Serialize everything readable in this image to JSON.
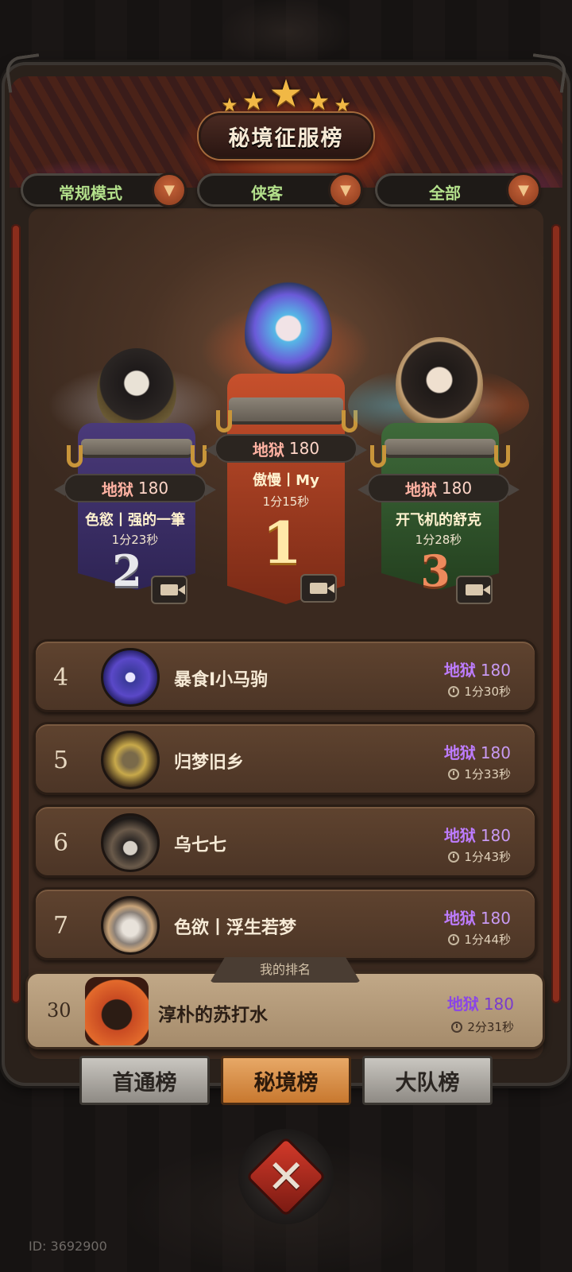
{
  "title": "秘境征服榜",
  "filters": [
    {
      "label": "常规模式"
    },
    {
      "label": "侠客"
    },
    {
      "label": "全部"
    }
  ],
  "podium": {
    "first": {
      "rank": "1",
      "tier": "地狱",
      "level": "180",
      "name": "傲慢丨My",
      "time": "1分15秒"
    },
    "second": {
      "rank": "2",
      "tier": "地狱",
      "level": "180",
      "name": "色慾丨强的一筆",
      "time": "1分23秒"
    },
    "third": {
      "rank": "3",
      "tier": "地狱",
      "level": "180",
      "name": "开飞机的舒克",
      "time": "1分28秒"
    }
  },
  "list": [
    {
      "rank": "4",
      "name": "暴食I小马驹",
      "tier": "地狱",
      "level": "180",
      "time": "1分30秒"
    },
    {
      "rank": "5",
      "name": "归梦旧乡",
      "tier": "地狱",
      "level": "180",
      "time": "1分33秒"
    },
    {
      "rank": "6",
      "name": "乌七七",
      "tier": "地狱",
      "level": "180",
      "time": "1分43秒"
    },
    {
      "rank": "7",
      "name": "色欲丨浮生若梦",
      "tier": "地狱",
      "level": "180",
      "time": "1分44秒"
    }
  ],
  "my_rank": {
    "tag": "我的排名",
    "rank": "30",
    "name": "淳朴的苏打水",
    "tier": "地狱",
    "level": "180",
    "time": "2分31秒"
  },
  "tabs": [
    {
      "label": "首通榜"
    },
    {
      "label": "秘境榜"
    },
    {
      "label": "大队榜"
    }
  ],
  "close_symbol": "✕",
  "stars": [
    "★",
    "★",
    "★",
    "★",
    "★"
  ],
  "user_id": "ID: 3692900",
  "colors": {
    "accent": "#c8782f",
    "tier_purple": "#bd7cff",
    "tier_red": "#ffb2a2"
  }
}
